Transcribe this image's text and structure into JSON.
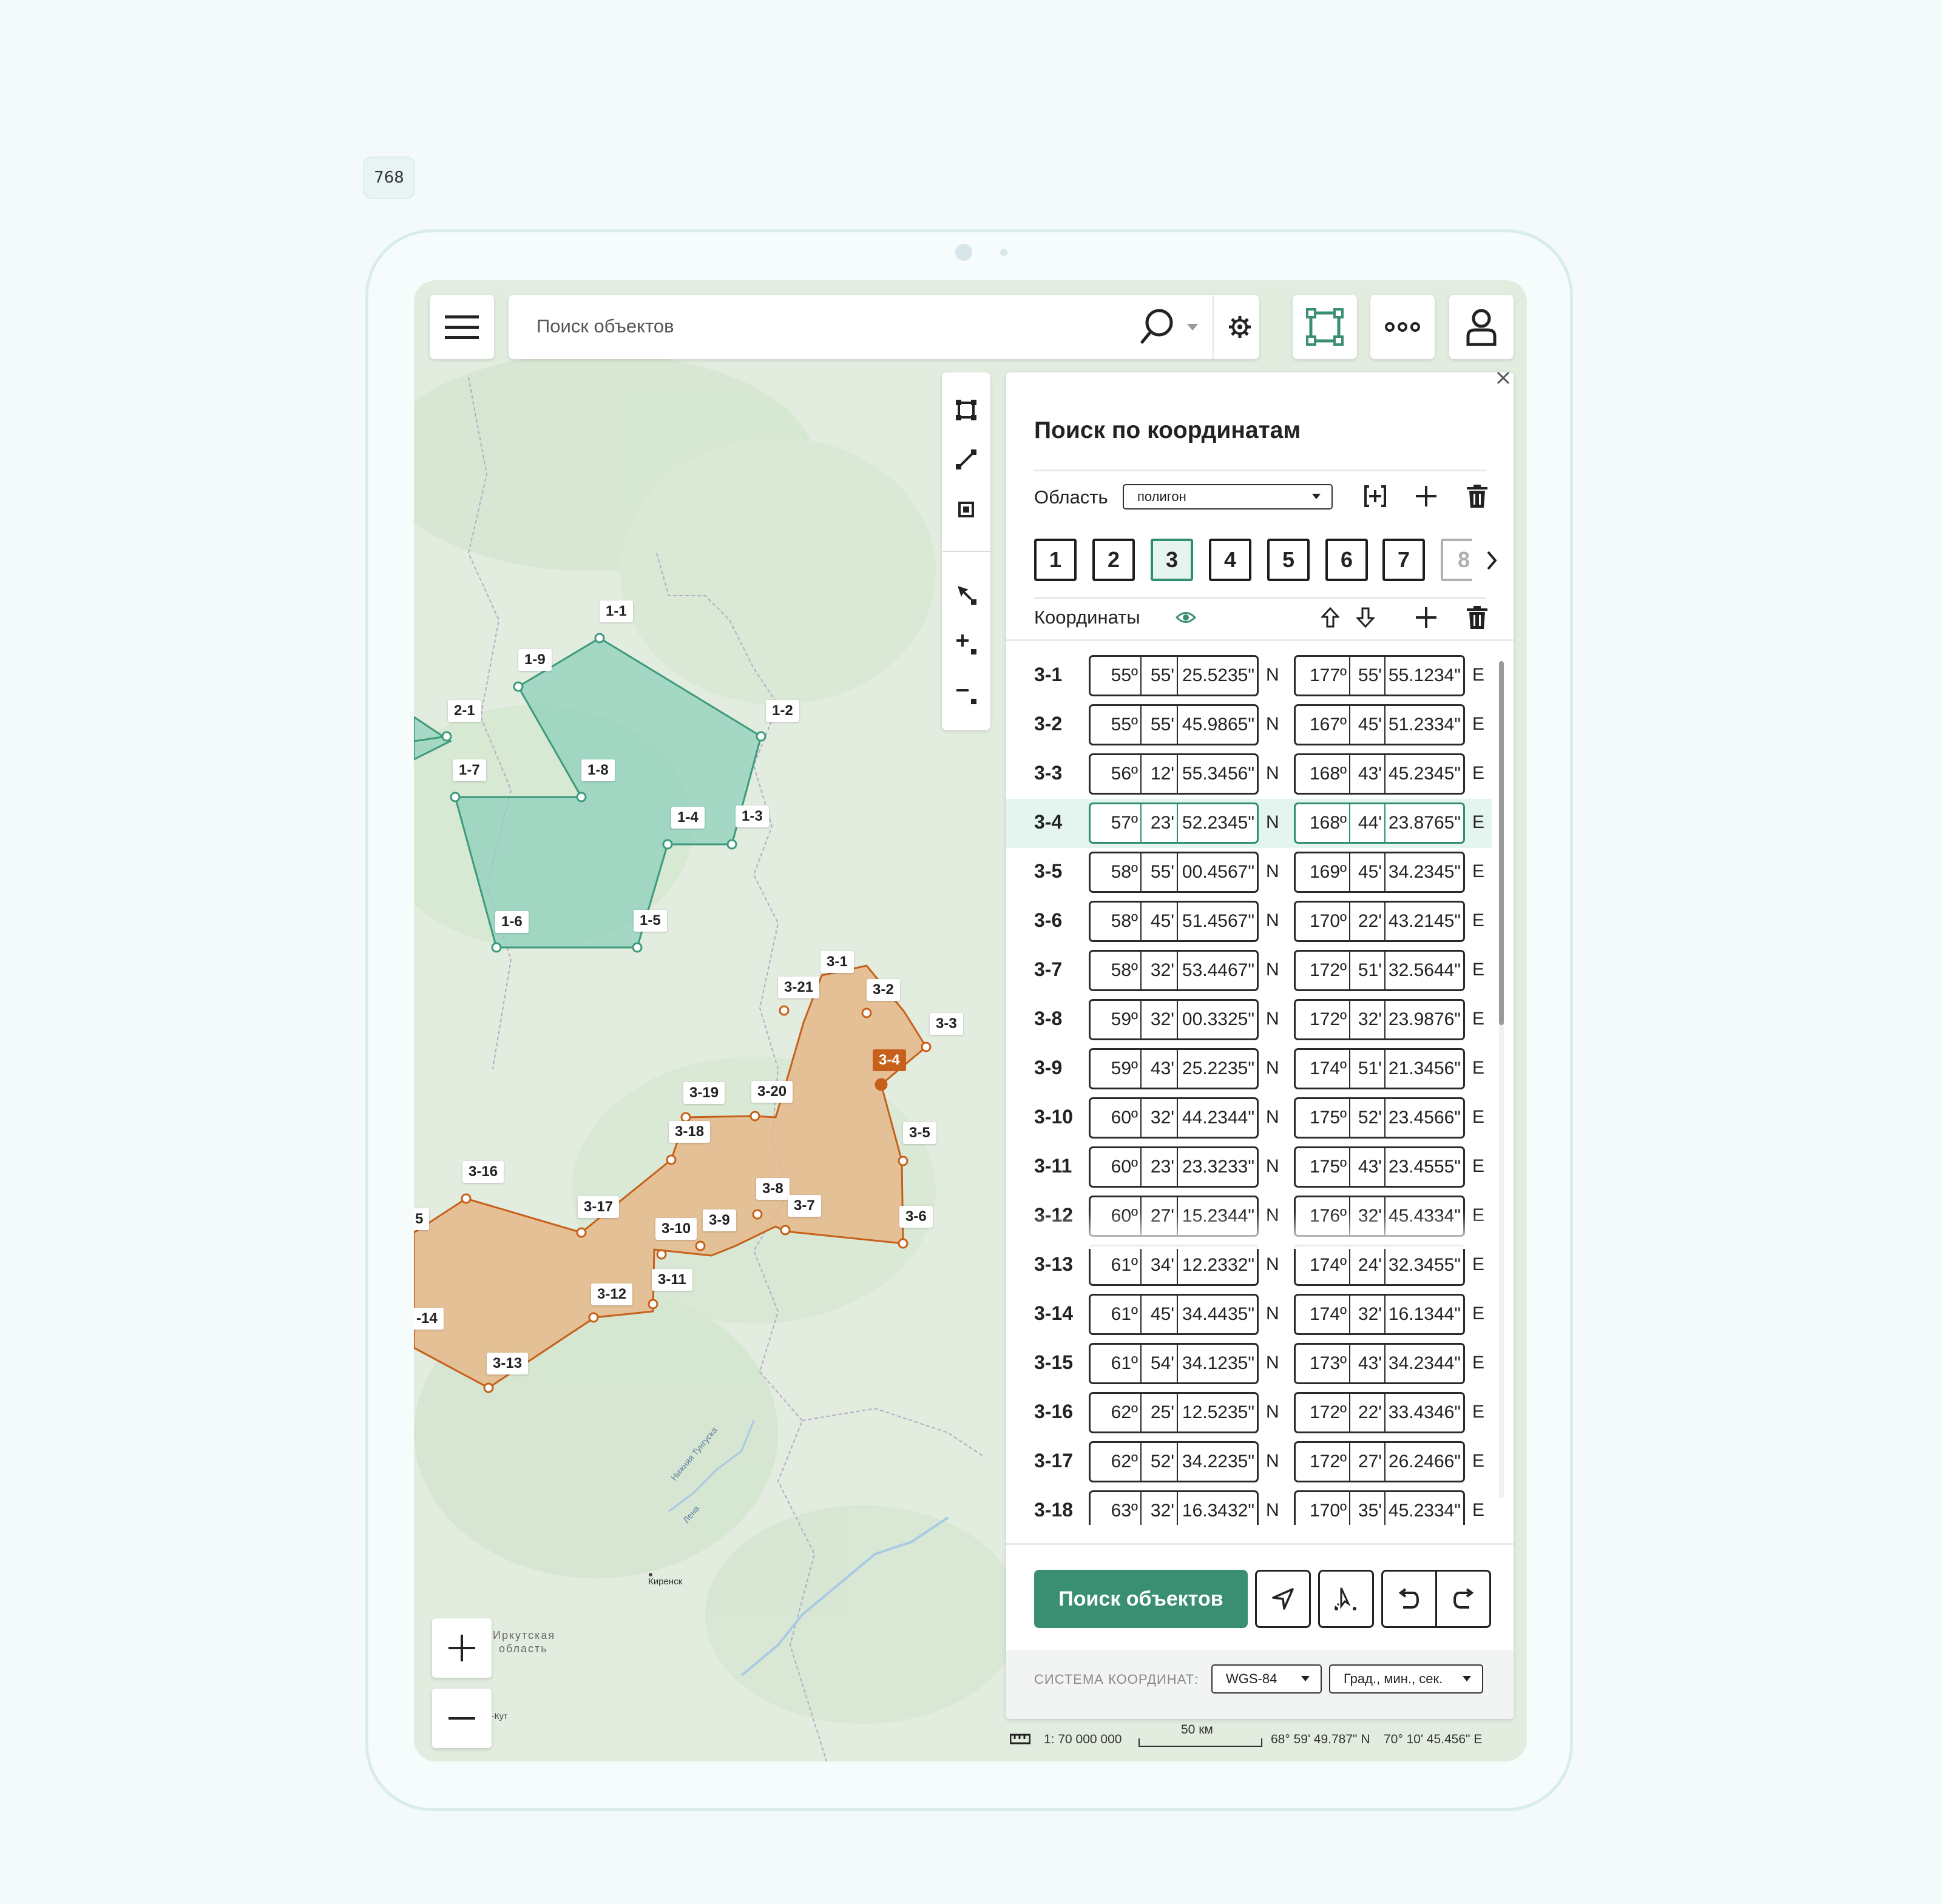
{
  "device": {
    "size_label": "768"
  },
  "search": {
    "placeholder": "Поиск объектов"
  },
  "panel": {
    "title": "Поиск по координатам",
    "area_label": "Область",
    "area_value": "полигон",
    "polygon_tabs": [
      "1",
      "2",
      "3",
      "4",
      "5",
      "6",
      "7",
      "8"
    ],
    "active_tab": "3",
    "coords_label": "Координаты",
    "rows": [
      {
        "id": "3-1",
        "lat": [
          "55º",
          "55'",
          "25.5235\""
        ],
        "lat_h": "N",
        "lon": [
          "177º",
          "55'",
          "55.1234\""
        ],
        "lon_h": "E"
      },
      {
        "id": "3-2",
        "lat": [
          "55º",
          "55'",
          "45.9865\""
        ],
        "lat_h": "N",
        "lon": [
          "167º",
          "45'",
          "51.2334\""
        ],
        "lon_h": "E"
      },
      {
        "id": "3-3",
        "lat": [
          "56º",
          "12'",
          "55.3456\""
        ],
        "lat_h": "N",
        "lon": [
          "168º",
          "43'",
          "45.2345\""
        ],
        "lon_h": "E"
      },
      {
        "id": "3-4",
        "lat": [
          "57º",
          "23'",
          "52.2345\""
        ],
        "lat_h": "N",
        "lon": [
          "168º",
          "44'",
          "23.8765\""
        ],
        "lon_h": "E"
      },
      {
        "id": "3-5",
        "lat": [
          "58º",
          "55'",
          "00.4567\""
        ],
        "lat_h": "N",
        "lon": [
          "169º",
          "45'",
          "34.2345\""
        ],
        "lon_h": "E"
      },
      {
        "id": "3-6",
        "lat": [
          "58º",
          "45'",
          "51.4567\""
        ],
        "lat_h": "N",
        "lon": [
          "170º",
          "22'",
          "43.2145\""
        ],
        "lon_h": "E"
      },
      {
        "id": "3-7",
        "lat": [
          "58º",
          "32'",
          "53.4467\""
        ],
        "lat_h": "N",
        "lon": [
          "172º",
          "51'",
          "32.5644\""
        ],
        "lon_h": "E"
      },
      {
        "id": "3-8",
        "lat": [
          "59º",
          "32'",
          "00.3325\""
        ],
        "lat_h": "N",
        "lon": [
          "172º",
          "32'",
          "23.9876\""
        ],
        "lon_h": "E"
      },
      {
        "id": "3-9",
        "lat": [
          "59º",
          "43'",
          "25.2235\""
        ],
        "lat_h": "N",
        "lon": [
          "174º",
          "51'",
          "21.3456\""
        ],
        "lon_h": "E"
      },
      {
        "id": "3-10",
        "lat": [
          "60º",
          "32'",
          "44.2344\""
        ],
        "lat_h": "N",
        "lon": [
          "175º",
          "52'",
          "23.4566\""
        ],
        "lon_h": "E"
      },
      {
        "id": "3-11",
        "lat": [
          "60º",
          "23'",
          "23.3233\""
        ],
        "lat_h": "N",
        "lon": [
          "175º",
          "43'",
          "23.4555\""
        ],
        "lon_h": "E"
      },
      {
        "id": "3-12",
        "lat": [
          "60º",
          "27'",
          "15.2344\""
        ],
        "lat_h": "N",
        "lon": [
          "176º",
          "32'",
          "45.4334\""
        ],
        "lon_h": "E"
      },
      {
        "id": "3-13",
        "lat": [
          "61º",
          "34'",
          "12.2332\""
        ],
        "lat_h": "N",
        "lon": [
          "174º",
          "24'",
          "32.3455\""
        ],
        "lon_h": "E"
      },
      {
        "id": "3-14",
        "lat": [
          "61º",
          "45'",
          "34.4435\""
        ],
        "lat_h": "N",
        "lon": [
          "174º",
          "32'",
          "16.1344\""
        ],
        "lon_h": "E"
      },
      {
        "id": "3-15",
        "lat": [
          "61º",
          "54'",
          "34.1235\""
        ],
        "lat_h": "N",
        "lon": [
          "173º",
          "43'",
          "34.2344\""
        ],
        "lon_h": "E"
      },
      {
        "id": "3-16",
        "lat": [
          "62º",
          "25'",
          "12.5235\""
        ],
        "lat_h": "N",
        "lon": [
          "172º",
          "22'",
          "33.4346\""
        ],
        "lon_h": "E"
      },
      {
        "id": "3-17",
        "lat": [
          "62º",
          "52'",
          "34.2235\""
        ],
        "lat_h": "N",
        "lon": [
          "172º",
          "27'",
          "26.2466\""
        ],
        "lon_h": "E"
      },
      {
        "id": "3-18",
        "lat": [
          "63º",
          "32'",
          "16.3432\""
        ],
        "lat_h": "N",
        "lon": [
          "170º",
          "35'",
          "45.2334\""
        ],
        "lon_h": "E"
      }
    ],
    "selected_row": "3-4",
    "search_button": "Поиск объектов",
    "crs_label": "СИСТЕМА КООРДИНАТ:",
    "crs_value": "WGS-84",
    "format_value": "Град., мин., сек."
  },
  "status": {
    "scale": "1: 70 000 000",
    "scalebar": "50 км",
    "lat": "68° 59' 49.787\" N",
    "lon": "70° 10' 45.456\" E"
  },
  "map": {
    "place_1": "Киренск",
    "region_line1": "Иркутская",
    "region_line2": "область",
    "river_1": "Нижняя Тунгуска",
    "river_2": "Лена",
    "edge_label": "-Кут",
    "polygon1_labels": [
      "1-1",
      "1-2",
      "1-3",
      "1-4",
      "1-5",
      "1-6",
      "1-7",
      "1-8",
      "1-9"
    ],
    "polygon2_labels": [
      "2-1"
    ],
    "polygon3_labels": [
      "3-1",
      "3-2",
      "3-3",
      "3-4",
      "3-5",
      "3-6",
      "3-7",
      "3-8",
      "3-9",
      "3-10",
      "3-11",
      "3-12",
      "3-13",
      "-14",
      "5",
      "3-16",
      "3-17",
      "3-18",
      "3-19",
      "3-20",
      "3-21"
    ],
    "colors": {
      "polygon1_fill": "#8fd1bc",
      "polygon1_stroke": "#3c9a7b",
      "polygon3_fill": "#e5b88b",
      "polygon3_stroke": "#c7601a",
      "accent": "#2f8f6e"
    }
  }
}
